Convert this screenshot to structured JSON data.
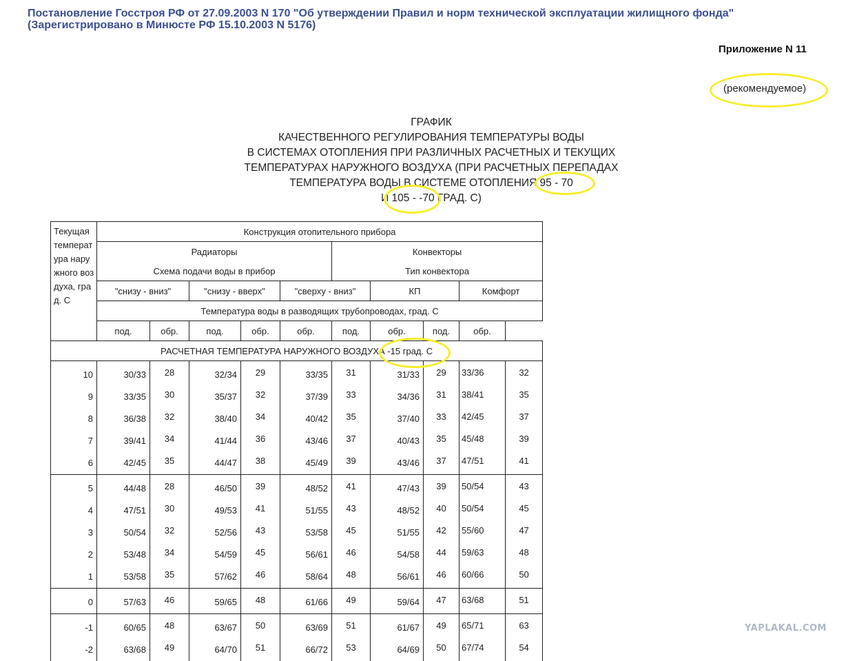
{
  "header": {
    "line1": "Постановление Госстроя РФ от 27.09.2003 N 170 \"Об утверждении Правил и норм технической эксплуатации жилищного фонда\"",
    "line2": "(Зарегистрировано в Минюсте РФ 15.10.2003 N 5176)"
  },
  "appendix": "Приложение N 11",
  "recommended": "(рекомендуемое)",
  "title": {
    "l1": "ГРАФИК",
    "l2": "КАЧЕСТВЕННОГО РЕГУЛИРОВАНИЯ ТЕМПЕРАТУРЫ ВОДЫ",
    "l3": "В СИСТЕМАХ ОТОПЛЕНИЯ ПРИ РАЗЛИЧНЫХ РАСЧЕТНЫХ И ТЕКУЩИХ",
    "l4": "ТЕМПЕРАТУРАХ НАРУЖНОГО ВОЗДУХА (ПРИ РАСЧЕТНЫХ ПЕРЕПАДАХ",
    "l5": "ТЕМПЕРАТУРА ВОДЫ В СИСТЕМЕ ОТОПЛЕНИЯ 95 - 70",
    "l6": "И 105 - -70 ГРАД. С)"
  },
  "table": {
    "first_col": "Текущая температура наружного воздуха, град. С",
    "construction": "Конструкция отопительного прибора",
    "radiators": "Радиаторы",
    "convectors": "Конвекторы",
    "radiator_scheme": "Схема подачи воды в прибор",
    "convector_type": "Тип конвектора",
    "scheme_1": "\"снизу - вниз\"",
    "scheme_2": "\"снизу - вверх\"",
    "scheme_3": "\"сверху - вниз\"",
    "conv_kp": "КП",
    "conv_comfort": "Комфорт",
    "pipe_temp": "Температура воды в разводящих трубопроводах, град. С",
    "sub": [
      "под.",
      "обр.",
      "под.",
      "обр.",
      "обр.",
      "под.",
      "обр.",
      "под.",
      "обр."
    ],
    "section": "РАСЧЕТНАЯ ТЕМПЕРАТУРА НАРУЖНОГО ВОЗДУХА -15 град. С",
    "rows": [
      [
        "10",
        "30/33",
        "28",
        "32/34",
        "29",
        "33/35",
        "31",
        "31/33",
        "29",
        "33/36",
        "32"
      ],
      [
        "9",
        "33/35",
        "30",
        "35/37",
        "32",
        "37/39",
        "33",
        "34/36",
        "31",
        "38/41",
        "35"
      ],
      [
        "8",
        "36/38",
        "32",
        "38/40",
        "34",
        "40/42",
        "35",
        "37/40",
        "33",
        "42/45",
        "37"
      ],
      [
        "7",
        "39/41",
        "34",
        "41/44",
        "36",
        "43/46",
        "37",
        "40/43",
        "35",
        "45/48",
        "39"
      ],
      [
        "6",
        "42/45",
        "35",
        "44/47",
        "38",
        "45/49",
        "39",
        "43/46",
        "37",
        "47/51",
        "41"
      ],
      [
        "5",
        "44/48",
        "28",
        "46/50",
        "39",
        "48/52",
        "41",
        "47/43",
        "39",
        "50/54",
        "43"
      ],
      [
        "4",
        "47/51",
        "30",
        "49/53",
        "41",
        "51/55",
        "43",
        "48/52",
        "40",
        "50/54",
        "45"
      ],
      [
        "3",
        "50/54",
        "32",
        "52/56",
        "43",
        "53/58",
        "45",
        "51/55",
        "42",
        "55/60",
        "47"
      ],
      [
        "2",
        "53/48",
        "34",
        "54/59",
        "45",
        "56/61",
        "46",
        "54/58",
        "44",
        "59/63",
        "48"
      ],
      [
        "1",
        "53/58",
        "35",
        "57/62",
        "46",
        "58/64",
        "48",
        "56/61",
        "46",
        "60/66",
        "50"
      ],
      [
        "0",
        "57/63",
        "46",
        "59/65",
        "48",
        "61/66",
        "49",
        "59/64",
        "47",
        "63/68",
        "51"
      ],
      [
        "-1",
        "60/65",
        "48",
        "63/67",
        "50",
        "63/69",
        "51",
        "61/67",
        "49",
        "65/71",
        "63"
      ],
      [
        "-2",
        "63/68",
        "49",
        "64/70",
        "51",
        "66/72",
        "53",
        "64/69",
        "50",
        "67/74",
        "54"
      ]
    ]
  },
  "watermark": "YAPLAKAL.COM",
  "colors": {
    "highlight": "#f6ee2c",
    "link": "#3c4f91",
    "watermark": "#aeb8c5"
  }
}
